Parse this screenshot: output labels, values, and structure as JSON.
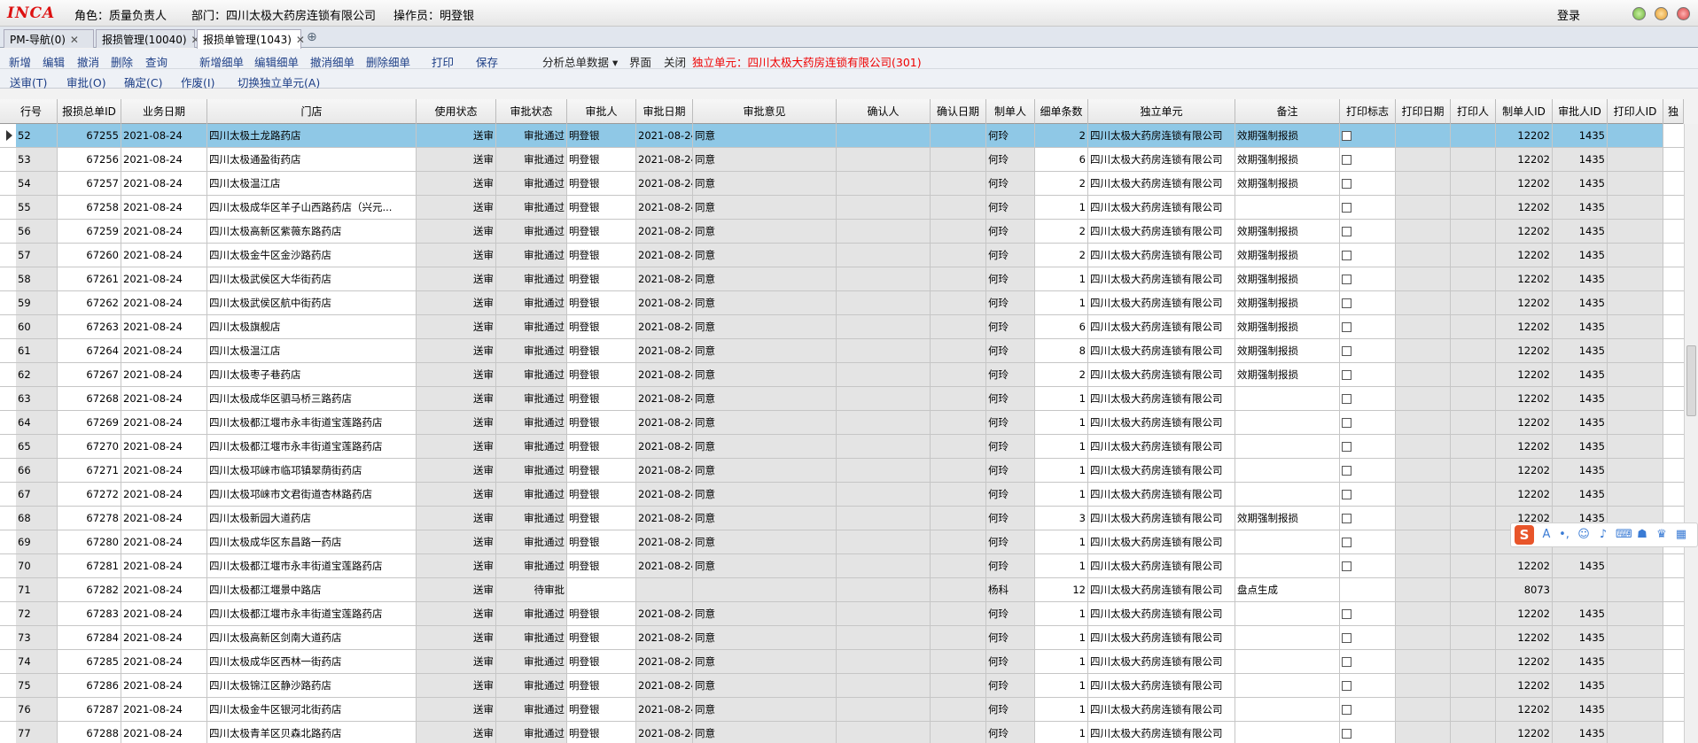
{
  "app": {
    "logo": "INCA",
    "role_label": "角色：质量负责人",
    "dept_label": "部门：四川太极大药房连锁有限公司",
    "operator_label": "操作员：明登银",
    "login": "登录"
  },
  "tabs": [
    {
      "label": "PM-导航(0)"
    },
    {
      "label": "报损管理(10040)"
    },
    {
      "label": "报损单管理(1043)"
    }
  ],
  "toolbar1": [
    "新增",
    "编辑",
    "撤消",
    "删除",
    "查询",
    "新增细单",
    "编辑细单",
    "撤消细单",
    "删除细单",
    "打印",
    "保存"
  ],
  "toolbar1_extra": {
    "analysis": "分析总单数据",
    "interface": "界面",
    "close": "关闭",
    "unit": "独立单元：四川太极大药房连锁有限公司(301)"
  },
  "toolbar2": [
    "送审(T)",
    "审批(O)",
    "确定(C)",
    "作废(I)",
    "切换独立单元(A)"
  ],
  "columns": [
    "行号",
    "报损总单ID",
    "业务日期",
    "门店",
    "使用状态",
    "审批状态",
    "审批人",
    "审批日期",
    "审批意见",
    "确认人",
    "确认日期",
    "制单人",
    "细单条数",
    "独立单元",
    "备注",
    "打印标志",
    "打印日期",
    "打印人",
    "制单人ID",
    "审批人ID",
    "打印人ID",
    "独"
  ],
  "rows": [
    [
      "52",
      "67255",
      "2021-08-24",
      "四川太极土龙路药店",
      "送审",
      "审批通过",
      "明登银",
      "2021-08-24",
      "同意",
      "",
      "",
      "何玲",
      "2",
      "四川太极大药房连锁有限公司",
      "效期强制报损",
      "cb",
      "",
      "",
      "12202",
      "1435",
      ""
    ],
    [
      "53",
      "67256",
      "2021-08-24",
      "四川太极通盈街药店",
      "送审",
      "审批通过",
      "明登银",
      "2021-08-24",
      "同意",
      "",
      "",
      "何玲",
      "6",
      "四川太极大药房连锁有限公司",
      "效期强制报损",
      "cb",
      "",
      "",
      "12202",
      "1435",
      ""
    ],
    [
      "54",
      "67257",
      "2021-08-24",
      "四川太极温江店",
      "送审",
      "审批通过",
      "明登银",
      "2021-08-24",
      "同意",
      "",
      "",
      "何玲",
      "2",
      "四川太极大药房连锁有限公司",
      "效期强制报损",
      "cb",
      "",
      "",
      "12202",
      "1435",
      ""
    ],
    [
      "55",
      "67258",
      "2021-08-24",
      "四川太极成华区羊子山西路药店（兴元...",
      "送审",
      "审批通过",
      "明登银",
      "2021-08-24",
      "同意",
      "",
      "",
      "何玲",
      "1",
      "四川太极大药房连锁有限公司",
      "",
      "cb",
      "",
      "",
      "12202",
      "1435",
      ""
    ],
    [
      "56",
      "67259",
      "2021-08-24",
      "四川太极高新区紫薇东路药店",
      "送审",
      "审批通过",
      "明登银",
      "2021-08-24",
      "同意",
      "",
      "",
      "何玲",
      "2",
      "四川太极大药房连锁有限公司",
      "效期强制报损",
      "cb",
      "",
      "",
      "12202",
      "1435",
      ""
    ],
    [
      "57",
      "67260",
      "2021-08-24",
      "四川太极金牛区金沙路药店",
      "送审",
      "审批通过",
      "明登银",
      "2021-08-24",
      "同意",
      "",
      "",
      "何玲",
      "2",
      "四川太极大药房连锁有限公司",
      "效期强制报损",
      "cb",
      "",
      "",
      "12202",
      "1435",
      ""
    ],
    [
      "58",
      "67261",
      "2021-08-24",
      "四川太极武侯区大华街药店",
      "送审",
      "审批通过",
      "明登银",
      "2021-08-24",
      "同意",
      "",
      "",
      "何玲",
      "1",
      "四川太极大药房连锁有限公司",
      "效期强制报损",
      "cb",
      "",
      "",
      "12202",
      "1435",
      ""
    ],
    [
      "59",
      "67262",
      "2021-08-24",
      "四川太极武侯区航中街药店",
      "送审",
      "审批通过",
      "明登银",
      "2021-08-24",
      "同意",
      "",
      "",
      "何玲",
      "1",
      "四川太极大药房连锁有限公司",
      "效期强制报损",
      "cb",
      "",
      "",
      "12202",
      "1435",
      ""
    ],
    [
      "60",
      "67263",
      "2021-08-24",
      "四川太极旗舰店",
      "送审",
      "审批通过",
      "明登银",
      "2021-08-24",
      "同意",
      "",
      "",
      "何玲",
      "6",
      "四川太极大药房连锁有限公司",
      "效期强制报损",
      "cb",
      "",
      "",
      "12202",
      "1435",
      ""
    ],
    [
      "61",
      "67264",
      "2021-08-24",
      "四川太极温江店",
      "送审",
      "审批通过",
      "明登银",
      "2021-08-24",
      "同意",
      "",
      "",
      "何玲",
      "8",
      "四川太极大药房连锁有限公司",
      "效期强制报损",
      "cb",
      "",
      "",
      "12202",
      "1435",
      ""
    ],
    [
      "62",
      "67267",
      "2021-08-24",
      "四川太极枣子巷药店",
      "送审",
      "审批通过",
      "明登银",
      "2021-08-24",
      "同意",
      "",
      "",
      "何玲",
      "2",
      "四川太极大药房连锁有限公司",
      "效期强制报损",
      "cb",
      "",
      "",
      "12202",
      "1435",
      ""
    ],
    [
      "63",
      "67268",
      "2021-08-24",
      "四川太极成华区驷马桥三路药店",
      "送审",
      "审批通过",
      "明登银",
      "2021-08-24",
      "同意",
      "",
      "",
      "何玲",
      "1",
      "四川太极大药房连锁有限公司",
      "",
      "cb",
      "",
      "",
      "12202",
      "1435",
      ""
    ],
    [
      "64",
      "67269",
      "2021-08-24",
      "四川太极都江堰市永丰街道宝莲路药店",
      "送审",
      "审批通过",
      "明登银",
      "2021-08-24",
      "同意",
      "",
      "",
      "何玲",
      "1",
      "四川太极大药房连锁有限公司",
      "",
      "cb",
      "",
      "",
      "12202",
      "1435",
      ""
    ],
    [
      "65",
      "67270",
      "2021-08-24",
      "四川太极都江堰市永丰街道宝莲路药店",
      "送审",
      "审批通过",
      "明登银",
      "2021-08-24",
      "同意",
      "",
      "",
      "何玲",
      "1",
      "四川太极大药房连锁有限公司",
      "",
      "cb",
      "",
      "",
      "12202",
      "1435",
      ""
    ],
    [
      "66",
      "67271",
      "2021-08-24",
      "四川太极邛崃市临邛镇翠荫街药店",
      "送审",
      "审批通过",
      "明登银",
      "2021-08-24",
      "同意",
      "",
      "",
      "何玲",
      "1",
      "四川太极大药房连锁有限公司",
      "",
      "cb",
      "",
      "",
      "12202",
      "1435",
      ""
    ],
    [
      "67",
      "67272",
      "2021-08-24",
      "四川太极邛崃市文君街道杏林路药店",
      "送审",
      "审批通过",
      "明登银",
      "2021-08-24",
      "同意",
      "",
      "",
      "何玲",
      "1",
      "四川太极大药房连锁有限公司",
      "",
      "cb",
      "",
      "",
      "12202",
      "1435",
      ""
    ],
    [
      "68",
      "67278",
      "2021-08-24",
      "四川太极新园大道药店",
      "送审",
      "审批通过",
      "明登银",
      "2021-08-24",
      "同意",
      "",
      "",
      "何玲",
      "3",
      "四川太极大药房连锁有限公司",
      "效期强制报损",
      "cb",
      "",
      "",
      "12202",
      "1435",
      ""
    ],
    [
      "69",
      "67280",
      "2021-08-24",
      "四川太极成华区东昌路一药店",
      "送审",
      "审批通过",
      "明登银",
      "2021-08-24",
      "同意",
      "",
      "",
      "何玲",
      "1",
      "四川太极大药房连锁有限公司",
      "",
      "cb",
      "",
      "",
      "12202",
      "1435",
      ""
    ],
    [
      "70",
      "67281",
      "2021-08-24",
      "四川太极都江堰市永丰街道宝莲路药店",
      "送审",
      "审批通过",
      "明登银",
      "2021-08-24",
      "同意",
      "",
      "",
      "何玲",
      "1",
      "四川太极大药房连锁有限公司",
      "",
      "cb",
      "",
      "",
      "12202",
      "1435",
      ""
    ],
    [
      "71",
      "67282",
      "2021-08-24",
      "四川太极都江堰景中路店",
      "送审",
      "待审批",
      "",
      "",
      "",
      "",
      "",
      "杨科",
      "12",
      "四川太极大药房连锁有限公司",
      "盘点生成",
      "",
      "",
      "",
      "8073",
      "",
      ""
    ],
    [
      "72",
      "67283",
      "2021-08-24",
      "四川太极都江堰市永丰街道宝莲路药店",
      "送审",
      "审批通过",
      "明登银",
      "2021-08-24",
      "同意",
      "",
      "",
      "何玲",
      "1",
      "四川太极大药房连锁有限公司",
      "",
      "cb",
      "",
      "",
      "12202",
      "1435",
      ""
    ],
    [
      "73",
      "67284",
      "2021-08-24",
      "四川太极高新区剑南大道药店",
      "送审",
      "审批通过",
      "明登银",
      "2021-08-24",
      "同意",
      "",
      "",
      "何玲",
      "1",
      "四川太极大药房连锁有限公司",
      "",
      "cb",
      "",
      "",
      "12202",
      "1435",
      ""
    ],
    [
      "74",
      "67285",
      "2021-08-24",
      "四川太极成华区西林一街药店",
      "送审",
      "审批通过",
      "明登银",
      "2021-08-24",
      "同意",
      "",
      "",
      "何玲",
      "1",
      "四川太极大药房连锁有限公司",
      "",
      "cb",
      "",
      "",
      "12202",
      "1435",
      ""
    ],
    [
      "75",
      "67286",
      "2021-08-24",
      "四川太极锦江区静沙路药店",
      "送审",
      "审批通过",
      "明登银",
      "2021-08-24",
      "同意",
      "",
      "",
      "何玲",
      "1",
      "四川太极大药房连锁有限公司",
      "",
      "cb",
      "",
      "",
      "12202",
      "1435",
      ""
    ],
    [
      "76",
      "67287",
      "2021-08-24",
      "四川太极金牛区银河北街药店",
      "送审",
      "审批通过",
      "明登银",
      "2021-08-24",
      "同意",
      "",
      "",
      "何玲",
      "1",
      "四川太极大药房连锁有限公司",
      "",
      "cb",
      "",
      "",
      "12202",
      "1435",
      ""
    ],
    [
      "77",
      "67288",
      "2021-08-24",
      "四川太极青羊区贝森北路药店",
      "送审",
      "审批通过",
      "明登银",
      "2021-08-24",
      "同意",
      "",
      "",
      "何玲",
      "1",
      "四川太极大药房连锁有限公司",
      "",
      "cb",
      "",
      "",
      "12202",
      "1435",
      ""
    ]
  ],
  "ime": {
    "label": "S"
  }
}
